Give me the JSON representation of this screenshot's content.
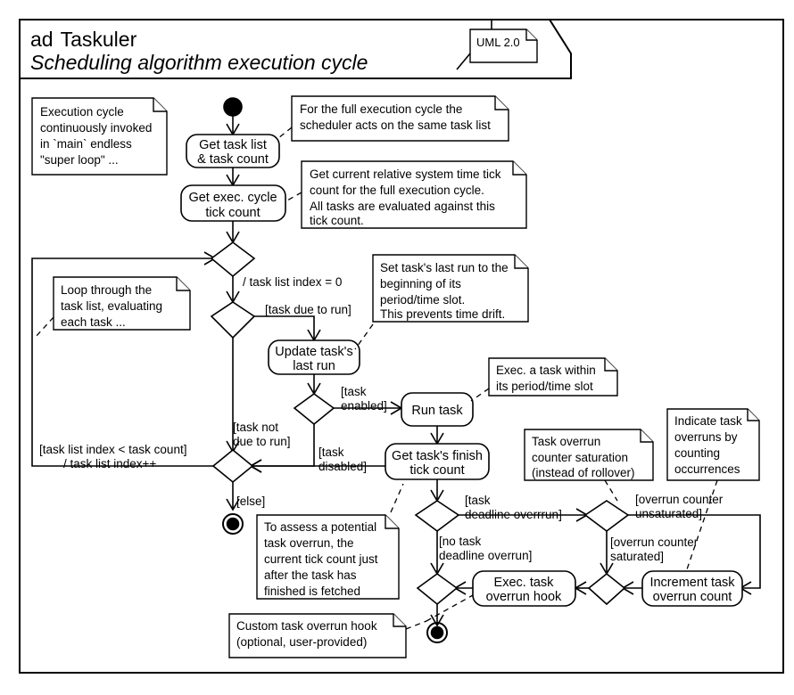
{
  "frame": {
    "kind_prefix": "ad",
    "name": "Taskuler",
    "subtitle": "Scheduling algorithm execution cycle",
    "standard_tag": "UML 2.0"
  },
  "nodes": {
    "initial": "initial-node",
    "get_task_list": "Get task list\n& task count",
    "get_exec_cycle": "Get exec. cycle\ntick count",
    "update_last_run": "Update task's\nlast run",
    "run_task": "Run task",
    "get_finish_tick": "Get task's finish\ntick count",
    "exec_overrun_hook": "Exec. task\noverrun hook",
    "increment_overrun": "Increment task\noverrun count"
  },
  "guards": {
    "task_list_index_init": "/ task list index = 0",
    "task_due": "[task due to run]",
    "task_not_due": "[task not\ndue to run]",
    "task_enabled": "[task\nenabled]",
    "task_disabled": "[task\ndisabled]",
    "loop_back": "[task list index < task count]\n/ task list index++",
    "else": "[else]",
    "deadline_overrun": "[task\ndeadline overrrun]",
    "no_deadline_overrun": "[no task\ndeadline overrun]",
    "counter_unsaturated": "[overrun counter\nunsaturated]",
    "counter_saturated": "[overrun counter\nsaturated]"
  },
  "notes": {
    "exec_cycle_loop": "Execution cycle\ncontinuously invoked\nin `main` endless\n\"super loop\" ...",
    "same_task_list": "For the full execution cycle the\nscheduler acts on the same task list",
    "relative_tick": "Get current relative system time tick\ncount for the full execution cycle.\nAll tasks are evaluated against this\ntick count.",
    "loop_through": "Loop through the\ntask list, evaluating\neach task ...",
    "set_last_run": "Set task's last run to the\nbeginning of its\nperiod/time slot.\nThis prevents time drift.",
    "exec_within_slot": "Exec. a task within\nits period/time slot",
    "counter_saturation": "Task overrun\ncounter saturation\n(instead of rollover)",
    "indicate_overruns": "Indicate task\noverruns by\ncounting\noccurrences",
    "assess_overrun": "To assess a potential\ntask overrun, the\ncurrent tick count just\nafter the task has\nfinished is fetched",
    "custom_hook": "Custom task overrun hook\n(optional, user-provided)"
  },
  "colors": {
    "stroke": "#000000",
    "fill": "#ffffff"
  }
}
